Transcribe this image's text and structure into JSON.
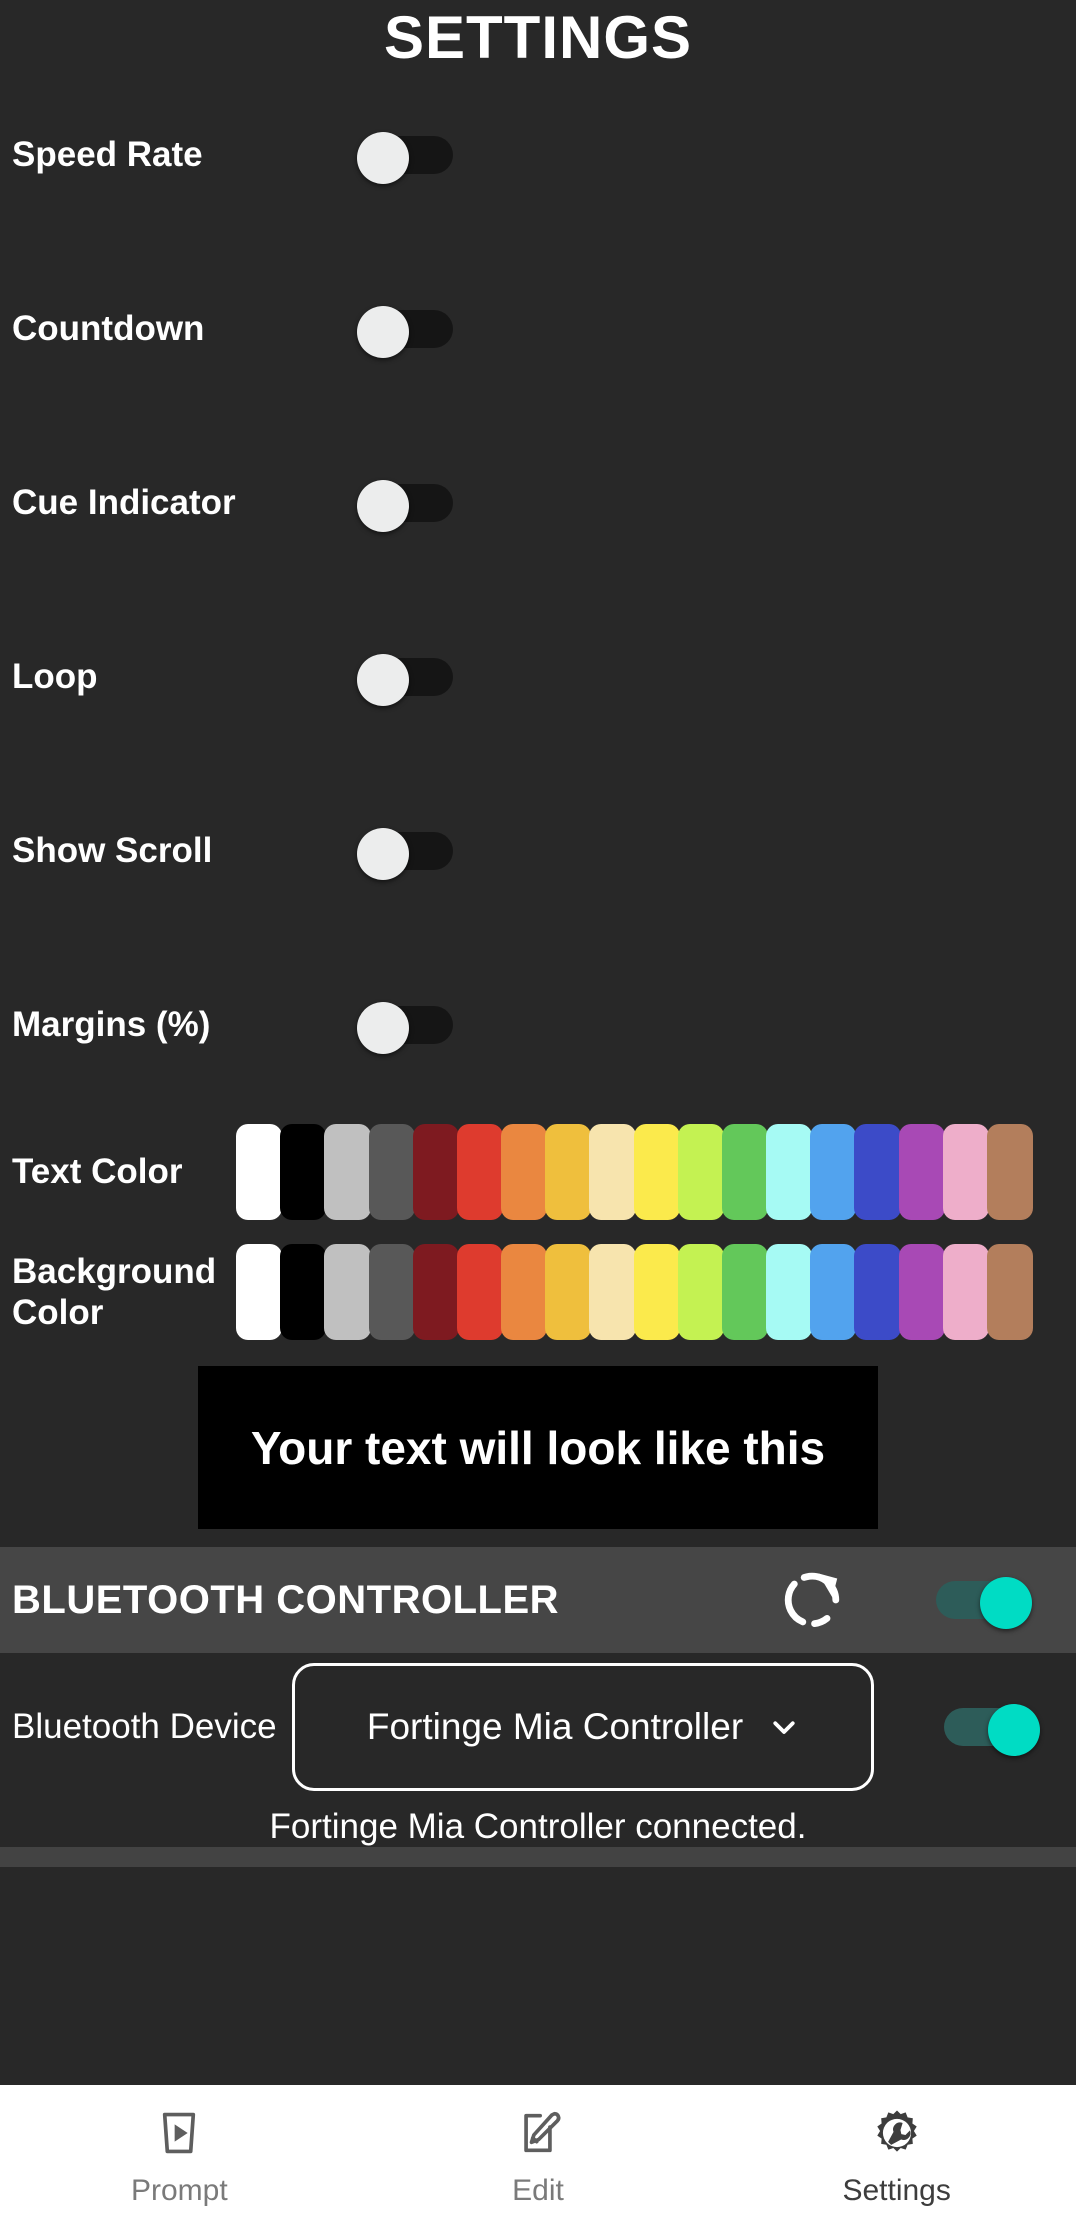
{
  "header": {
    "title": "SETTINGS"
  },
  "settings": {
    "rows": [
      {
        "label": "Speed Rate",
        "toggle": "off",
        "icon": "toggle-switch-icon"
      },
      {
        "label": "Countdown",
        "toggle": "off",
        "icon": "toggle-switch-icon"
      },
      {
        "label": "Cue Indicator",
        "toggle": "off",
        "icon": "toggle-switch-icon"
      },
      {
        "label": "Loop",
        "toggle": "off",
        "icon": "toggle-switch-icon"
      },
      {
        "label": "Show Scroll",
        "toggle": "off",
        "icon": "toggle-switch-icon"
      },
      {
        "label": "Margins (%)",
        "toggle": "off",
        "icon": "toggle-switch-icon"
      }
    ]
  },
  "text_color": {
    "label": "Text Color",
    "selected": "#FFFFFF",
    "swatches": [
      "#FFFFFF",
      "#000000",
      "#C0C0C0",
      "#585858",
      "#7E1A20",
      "#DE3B2E",
      "#EA8740",
      "#EFBF3D",
      "#F7E4AE",
      "#FBEA4C",
      "#C4F252",
      "#63C85A",
      "#A6FAF4",
      "#52A3EE",
      "#3C4BC8",
      "#A849B5",
      "#EEAECA",
      "#B37E5C"
    ]
  },
  "background_color": {
    "label": "Background Color",
    "selected": "#000000",
    "swatches": [
      "#FFFFFF",
      "#000000",
      "#C0C0C0",
      "#585858",
      "#7E1A20",
      "#DE3B2E",
      "#EA8740",
      "#EFBF3D",
      "#F7E4AE",
      "#FBEA4C",
      "#C4F252",
      "#63C85A",
      "#A6FAF4",
      "#52A3EE",
      "#3C4BC8",
      "#A849B5",
      "#EEAECA",
      "#B37E5C"
    ]
  },
  "preview": {
    "text": "Your text will look like this",
    "text_color": "#FFFFFF",
    "background_color": "#000000"
  },
  "bluetooth": {
    "section_title": "BLUETOOTH CONTROLLER",
    "refresh_icon": "refresh-icon",
    "section_toggle": "on",
    "device_label": "Bluetooth Device",
    "device_selected": "Fortinge Mia Controller",
    "device_options": [
      "Fortinge Mia Controller"
    ],
    "chevron_icon": "chevron-down-icon",
    "device_toggle": "on",
    "status": "Fortinge Mia Controller connected.",
    "accent_color": "#00DCC4"
  },
  "bottom_nav": {
    "items": [
      {
        "label": "Prompt",
        "icon": "teleprompter-play-icon",
        "active": false
      },
      {
        "label": "Edit",
        "icon": "edit-pencil-icon",
        "active": false
      },
      {
        "label": "Settings",
        "icon": "gear-wrench-icon",
        "active": true
      }
    ]
  }
}
